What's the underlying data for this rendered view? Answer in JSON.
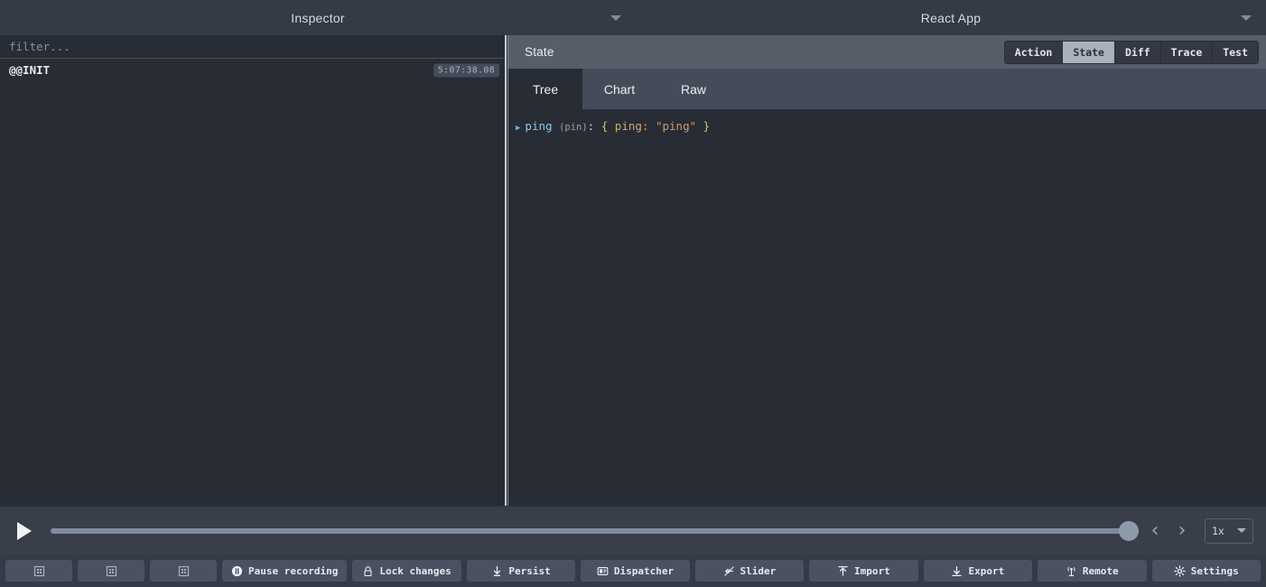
{
  "header": {
    "left_title": "Inspector",
    "right_title": "React App",
    "left_caret_icon": "chevron-down-icon",
    "right_caret_icon": "chevron-down-icon"
  },
  "actions_panel": {
    "filter_placeholder": "filter...",
    "filter_value": "",
    "items": [
      {
        "label": "@@INIT",
        "time": "5:07:38.08",
        "selected": true
      }
    ]
  },
  "inspector": {
    "title": "State",
    "monitor_tabs": [
      {
        "label": "Action",
        "active": false
      },
      {
        "label": "State",
        "active": true
      },
      {
        "label": "Diff",
        "active": false
      },
      {
        "label": "Trace",
        "active": false
      },
      {
        "label": "Test",
        "active": false
      }
    ],
    "sub_tabs": [
      {
        "label": "Tree",
        "active": true
      },
      {
        "label": "Chart",
        "active": false
      },
      {
        "label": "Raw",
        "active": false
      }
    ],
    "tree": {
      "arrow_glyph": "▶",
      "key": "ping",
      "meta": "(pin)",
      "colon": ":",
      "open_brace": "{",
      "prop": "ping:",
      "value": "\"ping\"",
      "close_brace": "}"
    }
  },
  "playback": {
    "play_icon": "play-icon",
    "slider_percent": 100,
    "prev_glyph": "‹",
    "next_glyph": "›",
    "speed_value": "1x",
    "speed_caret_icon": "chevron-down-icon"
  },
  "toolbar": {
    "dock_buttons": [
      {
        "icon": "dock-grid-icon"
      },
      {
        "icon": "dock-grid-icon"
      },
      {
        "icon": "dock-grid-icon"
      }
    ],
    "buttons": [
      {
        "label": "Pause recording",
        "icon": "pause-circle-icon"
      },
      {
        "label": "Lock changes",
        "icon": "lock-icon"
      },
      {
        "label": "Persist",
        "icon": "pin-icon"
      },
      {
        "label": "Dispatcher",
        "icon": "dispatcher-icon"
      },
      {
        "label": "Slider",
        "icon": "slider-off-icon"
      },
      {
        "label": "Import",
        "icon": "upload-icon"
      },
      {
        "label": "Export",
        "icon": "download-icon"
      },
      {
        "label": "Remote",
        "icon": "broadcast-icon"
      },
      {
        "label": "Settings",
        "icon": "gear-icon"
      }
    ]
  },
  "colors": {
    "background": "#282c34",
    "header": "#343a46",
    "inspector_bar": "#575d69",
    "subtabs": "#454b58",
    "accent_key": "#8fc7e8",
    "accent_string": "#cf9b66",
    "slider": "#7f8c9e"
  }
}
